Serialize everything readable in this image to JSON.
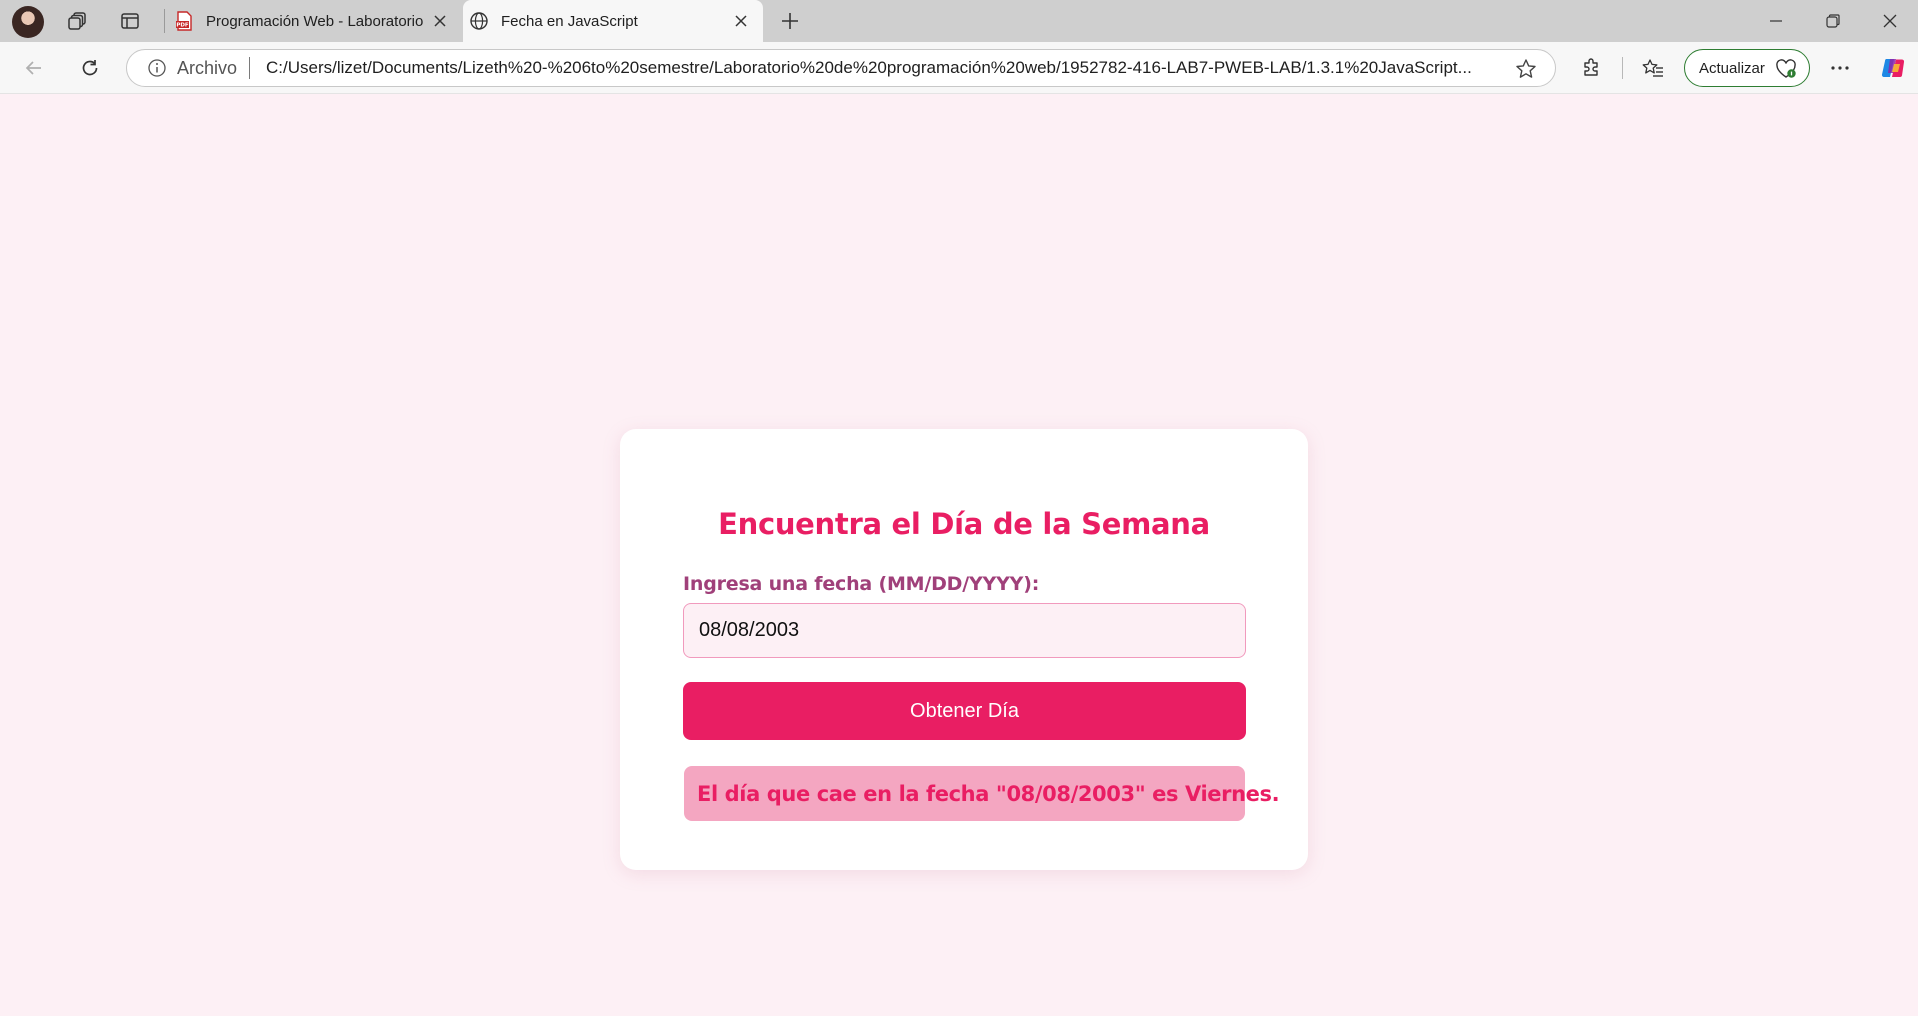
{
  "browser": {
    "tabs": [
      {
        "title": "Programación Web - Laboratorio",
        "icon": "pdf-icon",
        "active": false
      },
      {
        "title": "Fecha en JavaScript",
        "icon": "globe-icon",
        "active": true
      }
    ],
    "address_bar": {
      "scheme_label": "Archivo",
      "url": "C:/Users/lizet/Documents/Lizeth%20-%206to%20semestre/Laboratorio%20de%20programación%20web/1952782-416-LAB7-PWEB-LAB/1.3.1%20JavaScript..."
    },
    "update_button_label": "Actualizar",
    "colors": {
      "tabstrip": "#cfcfcf",
      "toolbar": "#f7f7f7",
      "update_border": "#2e7d32"
    }
  },
  "page": {
    "heading": "Encuentra el Día de la Semana",
    "date_label": "Ingresa una fecha (MM/DD/YYYY):",
    "date_value": "08/08/2003",
    "button_label": "Obtener Día",
    "result_text": "El día que cae en la fecha \"08/08/2003\" es Viernes.",
    "colors": {
      "background": "#fdf0f5",
      "accent": "#e91e63",
      "label": "#a0407a",
      "result_bg": "#f4a6c1"
    }
  }
}
